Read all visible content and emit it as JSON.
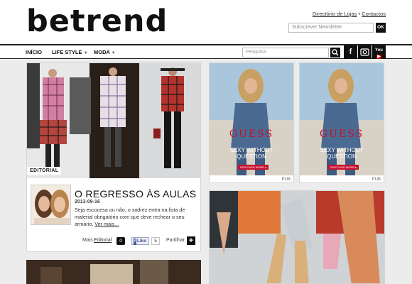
{
  "header": {
    "logo": "betrend",
    "links": [
      "Directório de Lojas",
      "Contactos"
    ],
    "separator": "•",
    "newsletter_placeholder": "Subscrever Newsletter",
    "ok_label": "OK"
  },
  "nav": {
    "items": [
      {
        "label": "INÍCIO",
        "has_dropdown": false
      },
      {
        "label": "LIFE STYLE",
        "has_dropdown": true
      },
      {
        "label": "MODA",
        "has_dropdown": true
      }
    ],
    "search_placeholder": "Pesquisa",
    "social": [
      {
        "icon": "facebook-icon",
        "glyph": "f"
      },
      {
        "icon": "instagram-icon",
        "glyph": "◙"
      },
      {
        "icon": "youtube-icon",
        "glyph": "You"
      }
    ]
  },
  "article": {
    "tag": "EDITORIAL",
    "title": "O REGRESSO ÀS AULAS",
    "date": "2013-09-16",
    "excerpt": "Seja escocesa ou não, o xadrez entra na lista de material obrigatório com que deve rechear o seu armário.",
    "more_link": "Ver mais...",
    "more_label": "Mais",
    "category_link": "Editorial",
    "comments": "0",
    "like_label": "Like",
    "like_count": "5",
    "share_label": "Partilhar"
  },
  "ads": [
    {
      "brand": "GUESS",
      "headline": "SEXY WITHOUT QUESTION",
      "cta": "DISCOVER MORE ▸",
      "label": "PUB"
    },
    {
      "brand": "GUESS",
      "headline": "SEXY WITHOUT QUESTION",
      "cta": "DISCOVER MORE ▸",
      "label": "PUB"
    }
  ],
  "colors": {
    "accent": "#111111",
    "background": "#ececec",
    "guess_red": "#c8102e",
    "facebook_blue": "#3b5998"
  }
}
